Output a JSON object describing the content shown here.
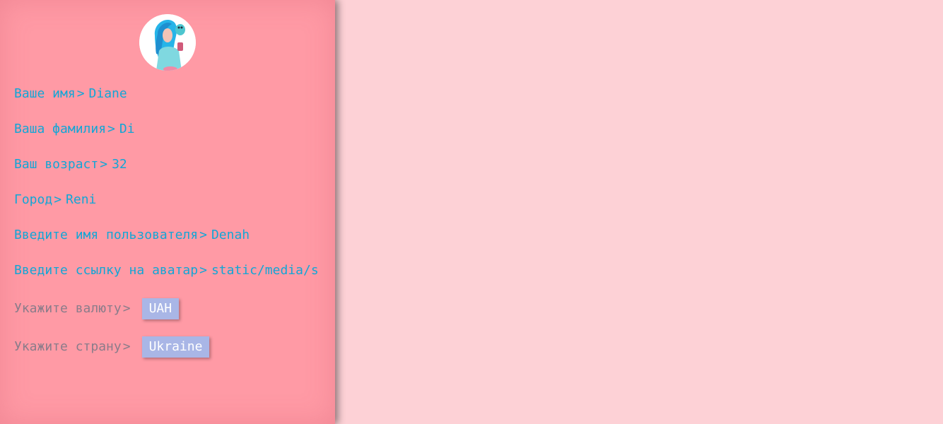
{
  "profile": {
    "first_name": {
      "label": "Ваше имя",
      "value": "Diane"
    },
    "last_name": {
      "label": "Ваша фамилия",
      "value": "Di"
    },
    "age": {
      "label": "Ваш возраст",
      "value": "32"
    },
    "city": {
      "label": "Город",
      "value": "Reni"
    },
    "username": {
      "label": "Введите имя пользователя",
      "value": "Denah"
    },
    "avatar_link": {
      "label": "Введите ссылку на аватар",
      "value": "static/media/s"
    },
    "currency": {
      "label": "Укажите валюту",
      "value": "UAH"
    },
    "country": {
      "label": "Укажите страну",
      "value": "Ukraine"
    }
  },
  "separator": ">",
  "colors": {
    "panel": "#ff9aa5",
    "background": "#fdd1d6",
    "text": "#12a6d6",
    "muted_text": "#8a7c8a",
    "pill": "#a9b6e6"
  },
  "icons": {
    "avatar": "user-avatar-image"
  }
}
